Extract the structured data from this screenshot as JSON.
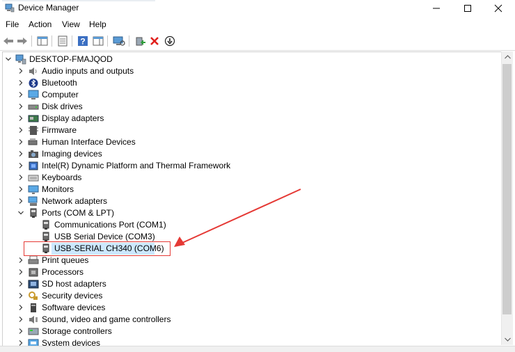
{
  "window": {
    "title": "Device Manager"
  },
  "menu": {
    "items": [
      "File",
      "Action",
      "View",
      "Help"
    ]
  },
  "tree": {
    "root": "DESKTOP-FMAJQOD",
    "items": [
      {
        "label": "Audio inputs and outputs",
        "icon": "speaker-icon",
        "expanded": false
      },
      {
        "label": "Bluetooth",
        "icon": "bluetooth-icon",
        "expanded": false
      },
      {
        "label": "Computer",
        "icon": "computer-icon",
        "expanded": false
      },
      {
        "label": "Disk drives",
        "icon": "disk-drive-icon",
        "expanded": false
      },
      {
        "label": "Display adapters",
        "icon": "display-adapter-icon",
        "expanded": false
      },
      {
        "label": "Firmware",
        "icon": "firmware-icon",
        "expanded": false
      },
      {
        "label": "Human Interface Devices",
        "icon": "hid-icon",
        "expanded": false
      },
      {
        "label": "Imaging devices",
        "icon": "camera-icon",
        "expanded": false
      },
      {
        "label": "Intel(R) Dynamic Platform and Thermal Framework",
        "icon": "chip-icon",
        "expanded": false
      },
      {
        "label": "Keyboards",
        "icon": "keyboard-icon",
        "expanded": false
      },
      {
        "label": "Monitors",
        "icon": "monitor-icon",
        "expanded": false
      },
      {
        "label": "Network adapters",
        "icon": "network-icon",
        "expanded": false
      },
      {
        "label": "Ports (COM & LPT)",
        "icon": "port-icon",
        "expanded": true,
        "children": [
          {
            "label": "Communications Port (COM1)",
            "icon": "port-icon"
          },
          {
            "label": "USB Serial Device (COM3)",
            "icon": "port-icon"
          },
          {
            "label": "USB-SERIAL CH340 (COM6)",
            "icon": "port-icon",
            "selected": true
          }
        ]
      },
      {
        "label": "Print queues",
        "icon": "printer-icon",
        "expanded": false
      },
      {
        "label": "Processors",
        "icon": "processor-icon",
        "expanded": false
      },
      {
        "label": "SD host adapters",
        "icon": "sd-card-icon",
        "expanded": false
      },
      {
        "label": "Security devices",
        "icon": "security-icon",
        "expanded": false
      },
      {
        "label": "Software devices",
        "icon": "software-icon",
        "expanded": false
      },
      {
        "label": "Sound, video and game controllers",
        "icon": "sound-icon",
        "expanded": false
      },
      {
        "label": "Storage controllers",
        "icon": "storage-icon",
        "expanded": false
      },
      {
        "label": "System devices",
        "icon": "system-icon",
        "expanded": false
      }
    ]
  },
  "colors": {
    "selection": "#cce8ff",
    "annotation": "#e53935"
  }
}
